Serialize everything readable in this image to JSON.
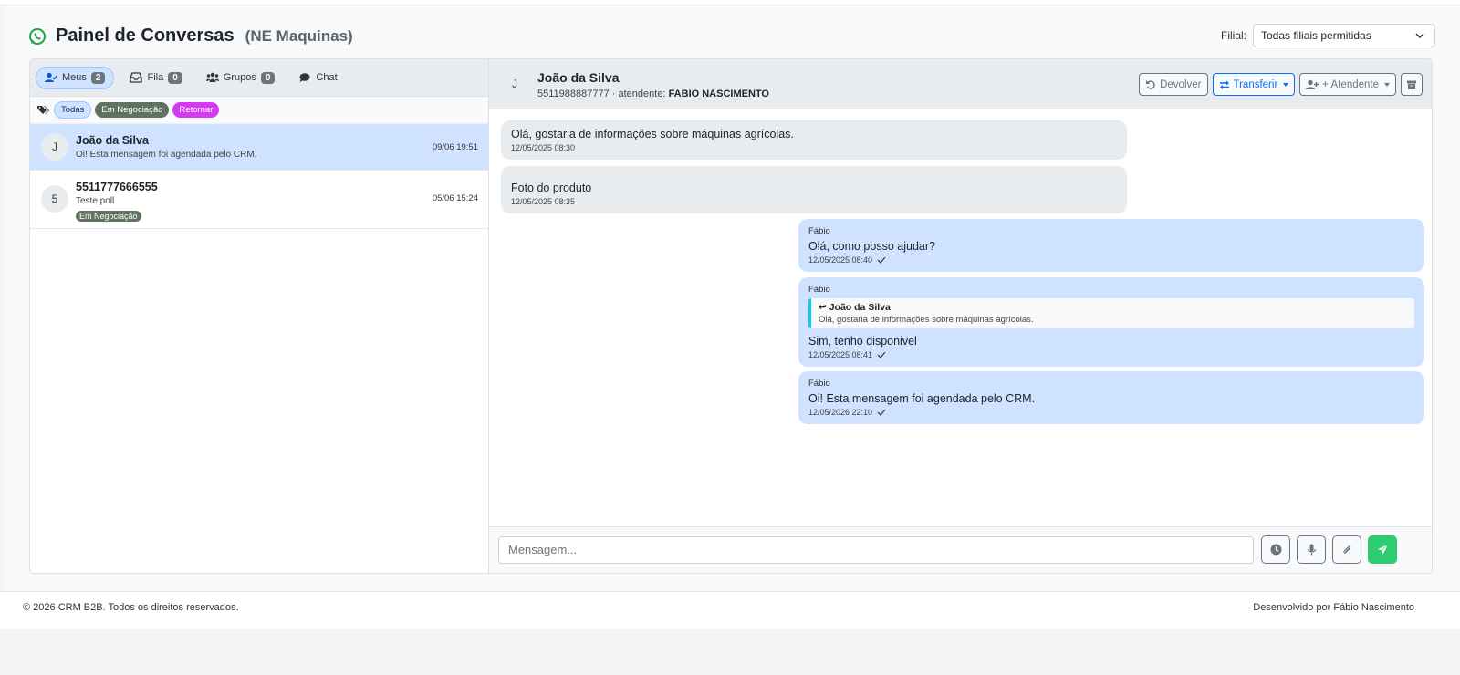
{
  "header": {
    "title": "Painel de Conversas",
    "subtitle": "(NE Maquinas)",
    "icon": "whatsapp-icon"
  },
  "filial": {
    "label": "Filial:",
    "value": "Todas filiais permitidas"
  },
  "tabs": [
    {
      "label": "Meus",
      "count": "2",
      "icon": "user-check-icon"
    },
    {
      "label": "Fila",
      "count": "0",
      "icon": "inbox-icon"
    },
    {
      "label": "Grupos",
      "count": "0",
      "icon": "users-icon"
    },
    {
      "label": "Chat",
      "icon": "chat-icon"
    }
  ],
  "tags": [
    "Todas",
    "Em Negociação",
    "Retornar"
  ],
  "conversations": [
    {
      "initial": "J",
      "name": "João da Silva",
      "preview": "Oi! Esta mensagem foi agendada pelo CRM.",
      "time": "09/06 19:51"
    },
    {
      "initial": "5",
      "name": "5511777666555",
      "preview": "Teste poll",
      "time": "05/06 15:24",
      "badge": "Em Negociação"
    }
  ],
  "chat": {
    "initial": "J",
    "name": "João da Silva",
    "phone": "5511988887777",
    "agent_prefix": "· atendente:",
    "agent": "FABIO NASCIMENTO",
    "actions": {
      "return": "Devolver",
      "transfer": "Transferir",
      "add_agent": "+ Atendente"
    }
  },
  "messages": [
    {
      "text": "Olá, gostaria de informações sobre máquinas agrícolas.",
      "stamp": "12/05/2025 08:30"
    },
    {
      "text": "Foto do produto",
      "stamp": "12/05/2025 08:35"
    },
    {
      "author": "Fábio",
      "text": "Olá, como posso ajudar?",
      "stamp": "12/05/2025 08:40"
    },
    {
      "author": "Fábio",
      "quote_name": "João da Silva",
      "quote_text": "Olá, gostaria de informações sobre máquinas agrícolas.",
      "text": "Sim, tenho disponivel",
      "stamp": "12/05/2025 08:41"
    },
    {
      "author": "Fábio",
      "text": "Oi! Esta mensagem foi agendada pelo CRM.",
      "stamp": "12/05/2026 22:10"
    }
  ],
  "composer": {
    "placeholder": "Mensagem..."
  },
  "footer": {
    "copyright": "© 2026 CRM B2B. Todos os direitos reservados.",
    "credit": "Desenvolvido por Fábio Nascimento"
  },
  "colors": {
    "primary": "#0d6efd",
    "active_bg": "#cfe2ff",
    "tag_negociacao": "#5f7360",
    "tag_retornar": "#d63af0",
    "send": "#2ecc71",
    "whatsapp": "#25a244"
  }
}
